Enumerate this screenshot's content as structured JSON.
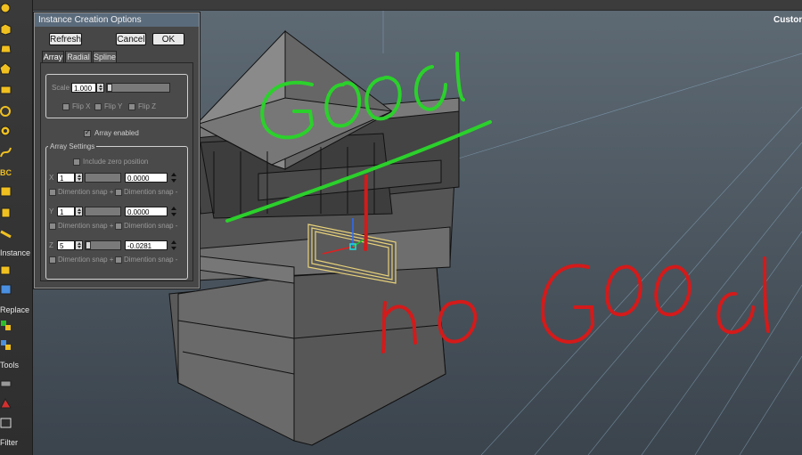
{
  "header": {
    "mode_label": "Custom"
  },
  "shelf": {
    "icons": [
      "sphere-icon",
      "cube-icon",
      "cylinder-icon",
      "cone-icon",
      "torus-icon",
      "plane-icon",
      "gear-icon",
      "curve-icon",
      "text-icon",
      "box-icon",
      "helix-icon"
    ],
    "section_instance": "Instance",
    "section_replace": "Replace",
    "section_tools": "Tools",
    "section_filter": "Filter"
  },
  "dialog": {
    "title": "Instance Creation Options",
    "buttons": {
      "refresh": "Refresh",
      "cancel": "Cancel",
      "ok": "OK"
    },
    "tabs": [
      {
        "label": "Array",
        "active": true
      },
      {
        "label": "Radial",
        "active": false
      },
      {
        "label": "Spline",
        "active": false
      }
    ],
    "scale": {
      "label": "Scale",
      "value": "1.000"
    },
    "flip": {
      "x": "Flip X",
      "y": "Flip Y",
      "z": "Flip Z"
    },
    "array_enabled": {
      "label": "Array enabled",
      "checked": true
    },
    "array_settings": {
      "group_title": "Array Settings",
      "include_zero": "Include zero position",
      "axes": [
        {
          "axis": "X",
          "count": "1",
          "offset": "0.0000",
          "snap_plus": "Dimention snap +",
          "snap_minus": "Dimention snap -"
        },
        {
          "axis": "Y",
          "count": "1",
          "offset": "0.0000",
          "snap_plus": "Dimention snap +",
          "snap_minus": "Dimention snap -"
        },
        {
          "axis": "Z",
          "count": "5",
          "offset": "-0.0281",
          "snap_plus": "Dimention snap +",
          "snap_minus": "Dimention snap -"
        }
      ]
    }
  },
  "annotations": {
    "good": "GOOD",
    "no_good": "no GOOd"
  },
  "colors": {
    "good": "#2bd12b",
    "no_good": "#d41a1a",
    "viewport_top": "#5d6a75",
    "viewport_bottom": "#3d4650"
  }
}
